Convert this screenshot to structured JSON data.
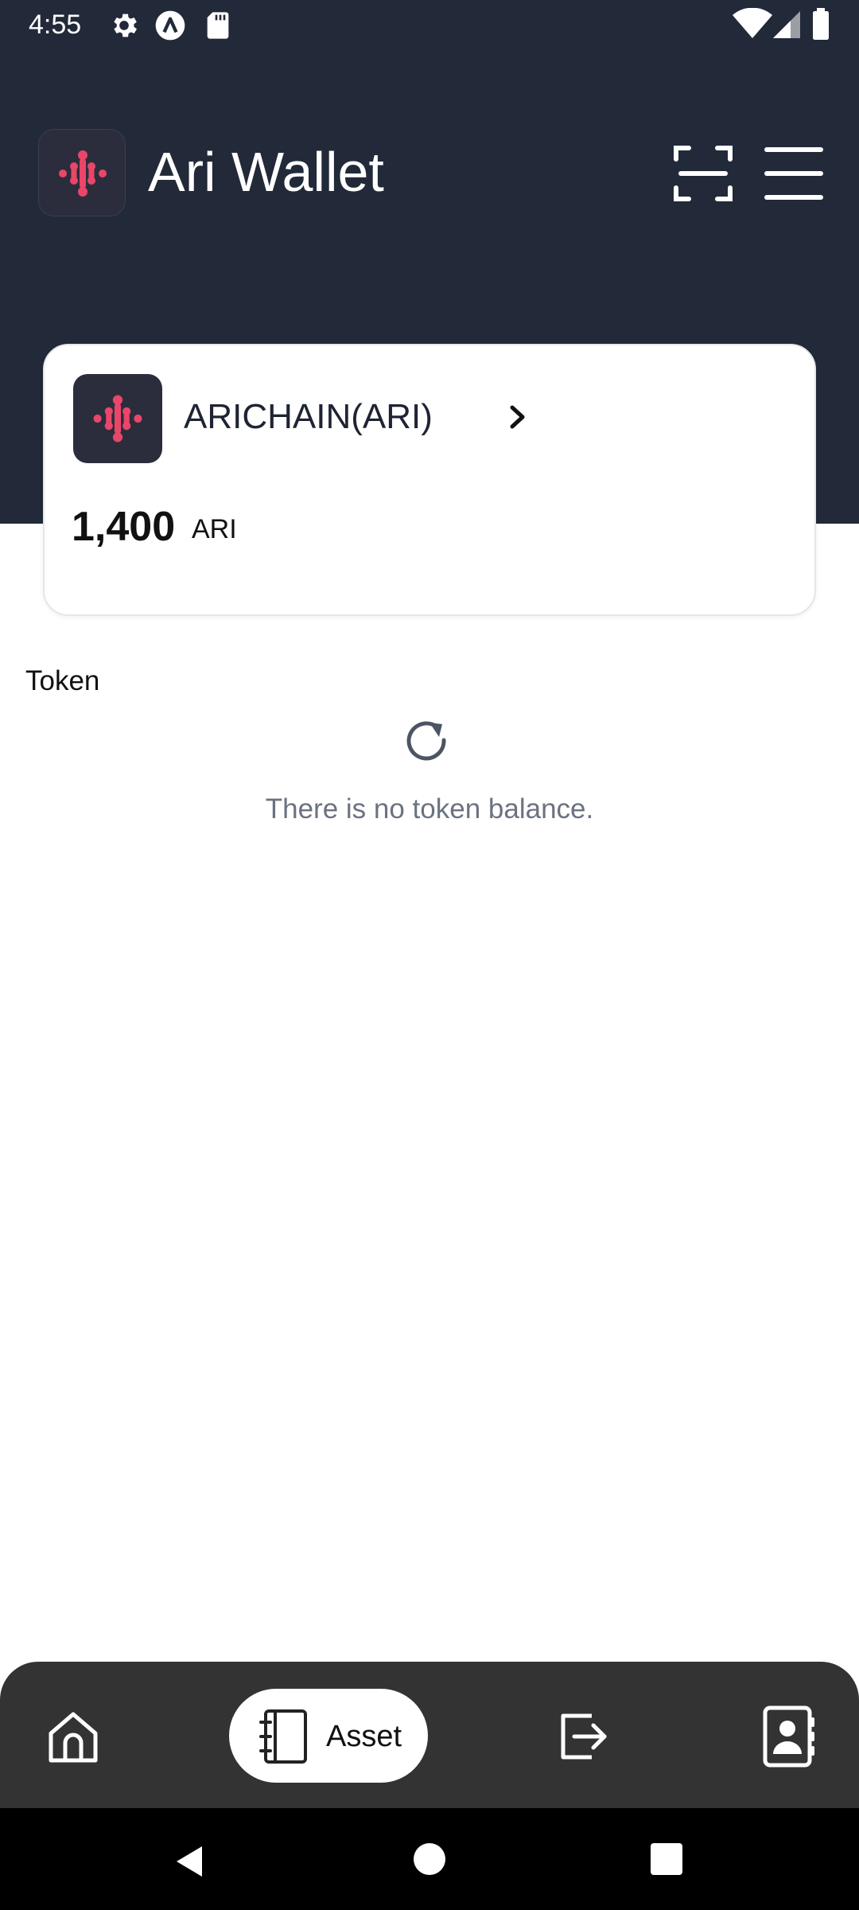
{
  "status_bar": {
    "time": "4:55",
    "left_icons": [
      "gear-icon",
      "app-a-icon",
      "sd-card-icon"
    ],
    "right_icons": [
      "wifi-icon",
      "signal-icon",
      "battery-icon"
    ]
  },
  "header": {
    "app_title": "Ari Wallet",
    "logo_icon": "ari-logo-icon",
    "actions": [
      "scan-icon",
      "menu-icon"
    ]
  },
  "wallet_card": {
    "chain_name": "ARICHAIN(ARI)",
    "balance_amount": "1,400",
    "balance_unit": "ARI"
  },
  "tokens": {
    "section_label": "Token",
    "empty_message": "There is no token balance."
  },
  "bottom_nav": {
    "items": [
      {
        "icon": "home-icon",
        "label": ""
      },
      {
        "icon": "notebook-icon",
        "label": "Asset",
        "active": true
      },
      {
        "icon": "transfer-icon",
        "label": ""
      },
      {
        "icon": "contacts-icon",
        "label": ""
      }
    ]
  },
  "colors": {
    "header_bg": "#222939",
    "accent_pink": "#e9466a",
    "nav_bg": "#333333",
    "muted_text": "#6b7280"
  }
}
